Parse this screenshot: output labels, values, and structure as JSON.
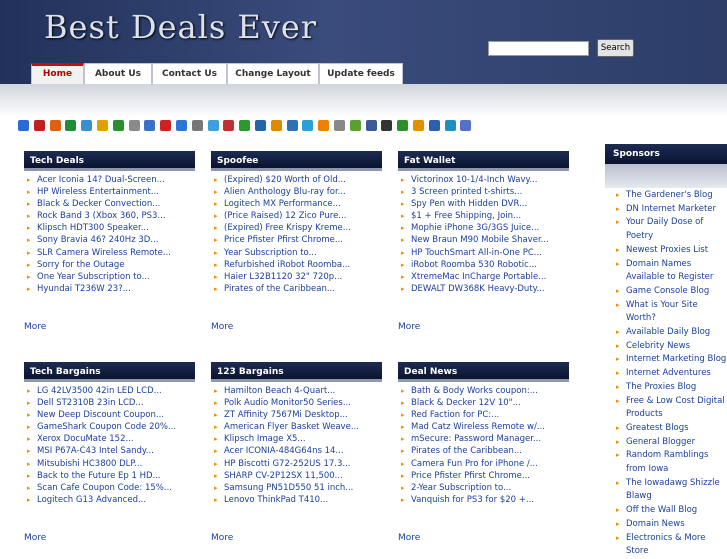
{
  "site": {
    "title": "Best Deals Ever"
  },
  "search": {
    "placeholder": "",
    "value": "",
    "button_label": "Search"
  },
  "nav": {
    "tabs": [
      {
        "label": "Home",
        "active": true
      },
      {
        "label": "About Us"
      },
      {
        "label": "Contact Us"
      },
      {
        "label": "Change Layout"
      },
      {
        "label": "Update feeds"
      }
    ]
  },
  "bookmark_icons": [
    "delicious-icon",
    "digg-icon",
    "reddit-icon",
    "stumbleupon-icon",
    "furl-icon",
    "blinklist-icon",
    "magnolia-icon",
    "newsvine-icon",
    "technorati-icon",
    "yahoo-icon",
    "google-icon",
    "blogmarks-icon",
    "spurl-icon",
    "ask-icon",
    "simpy-icon",
    "netscape-icon",
    "slashdot-icon",
    "diigo-icon",
    "live-icon",
    "rss-icon",
    "bookmark-icon",
    "feed-icon",
    "facebook-icon",
    "myspace-icon",
    "buzz-icon",
    "squidoo-icon",
    "mixx-icon",
    "email-icon",
    "help-icon"
  ],
  "boxes": [
    {
      "title": "Tech Deals",
      "more": "More",
      "items": [
        "Acer Iconia 14? Dual-Screen...",
        "HP Wireless Entertainment...",
        "Black & Decker Convection...",
        "Rock Band 3 (Xbox 360, PS3...",
        "Klipsch HDT300 Speaker...",
        "Sony Bravia 46? 240Hz 3D...",
        "SLR Camera Wireless Remote...",
        "Sorry for the Outage",
        "One Year Subscription to...",
        "Hyundai T236W 23?..."
      ]
    },
    {
      "title": "Spoofee",
      "more": "More",
      "items": [
        "(Expired) $20 Worth of Old...",
        "Alien Anthology Blu-ray for...",
        "Logitech MX Performance...",
        "(Price Raised) 12 Zico Pure...",
        "(Expired) Free Krispy Kreme...",
        "Price Pfister Pfirst Chrome...",
        "Year Subscription to...",
        "Refurbished iRobot Roomba...",
        "Haier L32B1120 32\" 720p...",
        "Pirates of the Caribbean..."
      ]
    },
    {
      "title": "Fat Wallet",
      "more": "More",
      "items": [
        "Victorinox 10-1/4-Inch Wavy...",
        "3 Screen printed t-shirts...",
        "Spy Pen with Hidden DVR...",
        "$1 + Free Shipping, Join...",
        "Mophie iPhone 3G/3GS Juice...",
        "New Braun M90 Mobile Shaver...",
        "HP TouchSmart All-in-One PC...",
        "iRobot Roomba 530 Robotic...",
        "XtremeMac InCharge Portable...",
        "DEWALT DW368K Heavy-Duty..."
      ]
    },
    {
      "title": "Tech Bargains",
      "more": "More",
      "items": [
        "LG 42LV3500 42in LED LCD...",
        "Dell ST2310B 23in LCD...",
        "New Deep Discount Coupon...",
        "GameShark Coupon Code 20%...",
        "Xerox DocuMate 152...",
        "MSI P67A-C43 Intel Sandy...",
        "Mitsubishi HC3800 DLP...",
        "Back to the Future Ep 1 HD...",
        "Scan Cafe Coupon Code: 15%...",
        "Logitech G13 Advanced..."
      ]
    },
    {
      "title": "123 Bargains",
      "more": "More",
      "items": [
        "Hamilton Beach 4-Quart...",
        "Polk Audio Monitor50 Series...",
        "ZT Affinity 7567Mi Desktop...",
        "American Flyer Basket Weave...",
        "Klipsch Image X5...",
        "Acer ICONIA-484G64ns 14...",
        "HP Biscotti G72-252US 17.3...",
        "SHARP CV-2P12SX 11,500...",
        "Samsung PN51D550 51 inch...",
        "Lenovo ThinkPad T410..."
      ]
    },
    {
      "title": "Deal News",
      "more": "More",
      "items": [
        "Bath & Body Works coupon:...",
        "Black & Decker 12V 10\"...",
        "Red Faction for PC:...",
        "Mad Catz Wireless Remote w/...",
        "mSecure: Password Manager...",
        "Pirates of the Caribbean...",
        "Camera Fun Pro for iPhone /...",
        "Price Pfister Pfirst Chrome...",
        "2-Year Subscription to...",
        "Vanquish for PS3 for $20 +..."
      ]
    }
  ],
  "sponsors": {
    "title": "Sponsors",
    "items": [
      "The Gardener's Blog",
      "DN Internet Marketer",
      "Your Daily Dose of Poetry",
      "Newest Proxies List",
      "Domain Names Available to Register",
      "Game Console Blog",
      "What is Your Site Worth?",
      "Available Daily Blog",
      "Celebrity News",
      "Internet Marketing Blog",
      "Internet Adventures",
      "The Proxies Blog",
      "Free & Low Cost Digital Products",
      "Greatest Blogs",
      "General Blogger",
      "Random Ramblings from Iowa",
      "The Iowadawg Shizzle Blawg",
      "Off the Wall Blog",
      "Domain News",
      "Electronics & More Store"
    ]
  }
}
